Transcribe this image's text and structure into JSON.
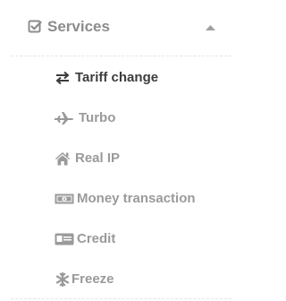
{
  "section": {
    "title": "Services",
    "icon": "check-square-icon",
    "expanded": true,
    "caret_icon": "caret-up-icon"
  },
  "colors": {
    "muted_text": "#9a9a9a",
    "active_text": "#3c3c3c",
    "icon_gray": "#9a9a9a",
    "divider": "#e6e6e6"
  },
  "menu": {
    "active_item": "Tariff change",
    "items": [
      {
        "label": "Tariff change",
        "icon": "exchange-arrows-icon"
      },
      {
        "label": "Turbo",
        "icon": "plane-icon"
      },
      {
        "label": "Real IP",
        "icon": "home-icon"
      },
      {
        "label": "Money transaction",
        "icon": "money-bill-icon"
      },
      {
        "label": "Credit",
        "icon": "credit-card-icon"
      },
      {
        "label": "Freeze",
        "icon": "snowflake-icon"
      }
    ]
  }
}
